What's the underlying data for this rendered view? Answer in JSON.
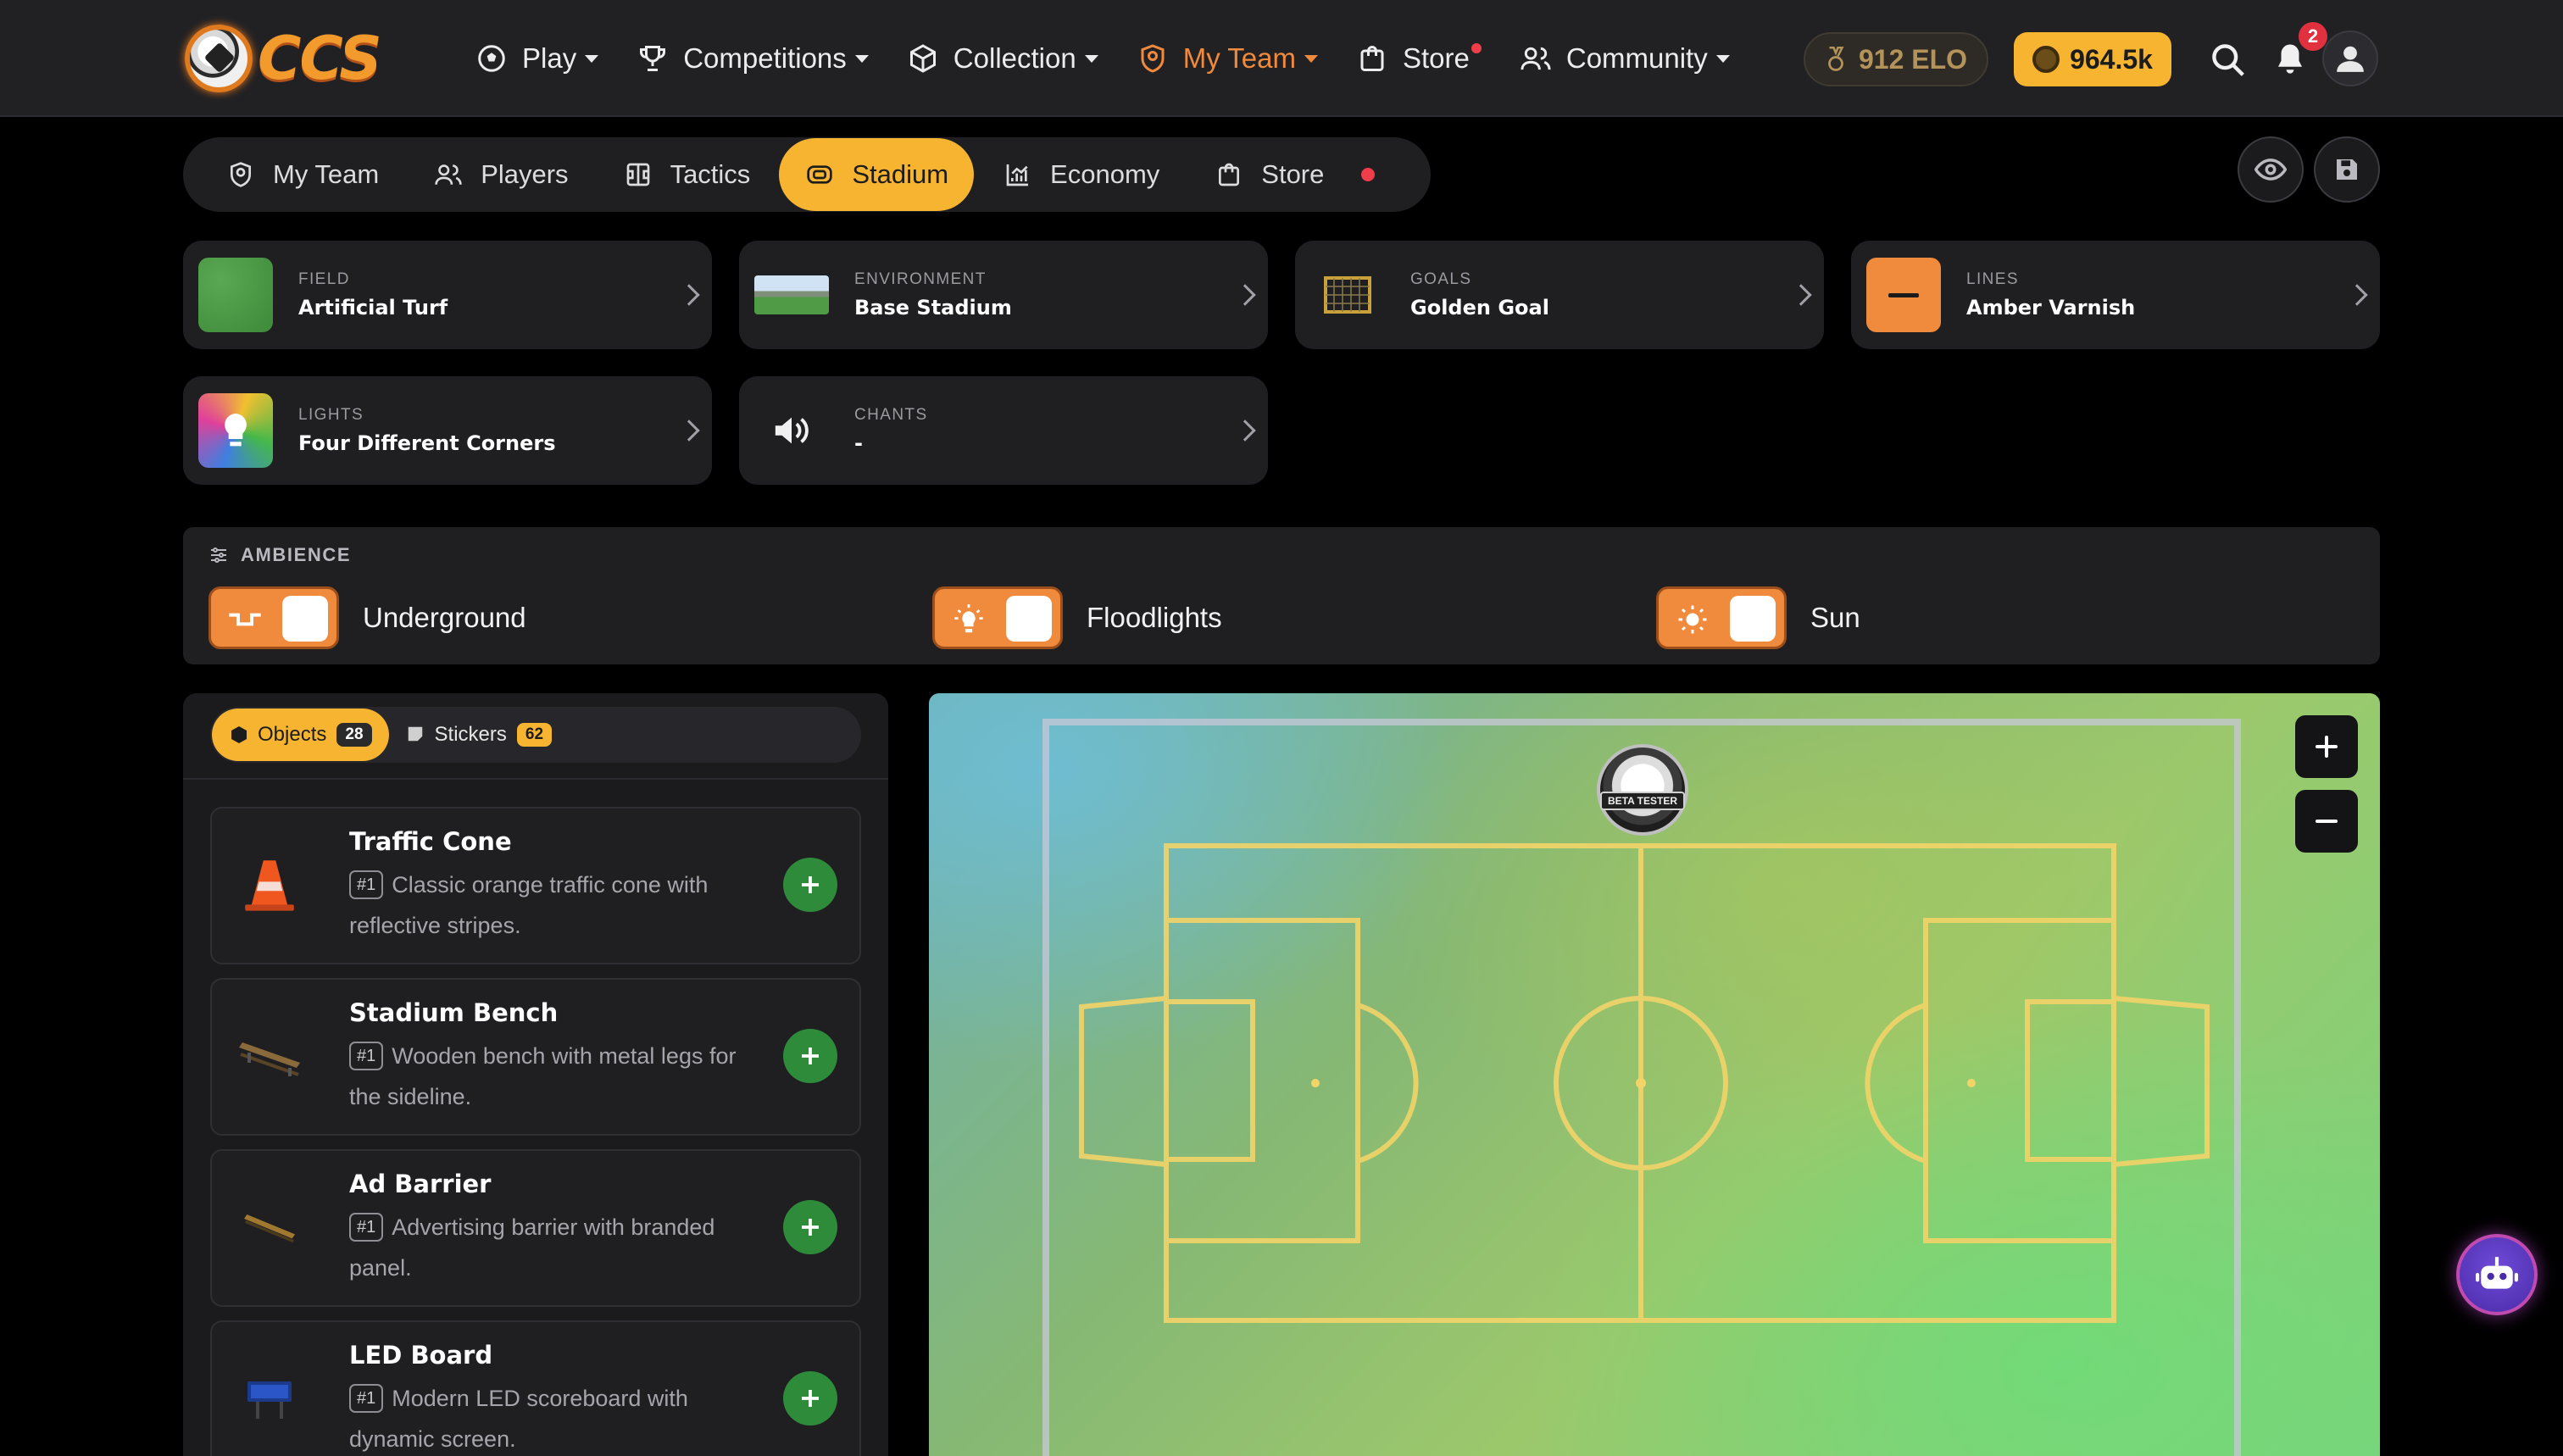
{
  "brand": {
    "logo_text": "CCS"
  },
  "nav": {
    "items": [
      {
        "label": "Play",
        "icon": "soccer-ball-icon"
      },
      {
        "label": "Competitions",
        "icon": "trophy-icon"
      },
      {
        "label": "Collection",
        "icon": "cube-icon"
      },
      {
        "label": "My Team",
        "icon": "shield-icon",
        "active": true
      },
      {
        "label": "Store",
        "icon": "bag-icon",
        "dot": true
      },
      {
        "label": "Community",
        "icon": "users-icon"
      }
    ],
    "elo": "912 ELO",
    "coins": "964.5k",
    "notifications": "2"
  },
  "subtabs": {
    "items": [
      {
        "label": "My Team",
        "icon": "shield-icon"
      },
      {
        "label": "Players",
        "icon": "users-icon"
      },
      {
        "label": "Tactics",
        "icon": "tactics-board-icon"
      },
      {
        "label": "Stadium",
        "icon": "stadium-icon",
        "active": true
      },
      {
        "label": "Economy",
        "icon": "chart-icon"
      },
      {
        "label": "Store",
        "icon": "bag-icon",
        "dot": true
      }
    ]
  },
  "config": {
    "field": {
      "label": "FIELD",
      "value": "Artificial Turf"
    },
    "environment": {
      "label": "ENVIRONMENT",
      "value": "Base Stadium"
    },
    "goals": {
      "label": "GOALS",
      "value": "Golden Goal"
    },
    "lines": {
      "label": "LINES",
      "value": "Amber Varnish"
    },
    "lights": {
      "label": "LIGHTS",
      "value": "Four Different Corners"
    },
    "chants": {
      "label": "CHANTS",
      "value": "-"
    }
  },
  "ambience": {
    "title": "AMBIENCE",
    "toggles": [
      {
        "label": "Underground",
        "icon": "underground-icon",
        "on": true
      },
      {
        "label": "Floodlights",
        "icon": "floodlight-icon",
        "on": true
      },
      {
        "label": "Sun",
        "icon": "sun-icon",
        "on": true
      }
    ]
  },
  "panel": {
    "tabs": [
      {
        "label": "Objects",
        "count": "28",
        "icon": "cube-icon",
        "active": true
      },
      {
        "label": "Stickers",
        "count": "62",
        "icon": "sticker-icon"
      }
    ],
    "objects": [
      {
        "title": "Traffic Cone",
        "tag": "#1",
        "description": "Classic orange traffic cone with reflective stripes.",
        "icon": "traffic-cone-icon"
      },
      {
        "title": "Stadium Bench",
        "tag": "#1",
        "description": "Wooden bench with metal legs for the sideline.",
        "icon": "bench-icon"
      },
      {
        "title": "Ad Barrier",
        "tag": "#1",
        "description": "Advertising barrier with branded panel.",
        "icon": "ad-barrier-icon"
      },
      {
        "title": "LED Board",
        "tag": "#1",
        "description": "Modern LED scoreboard with dynamic screen.",
        "icon": "led-board-icon"
      }
    ]
  },
  "pitch": {
    "sticker_text": "BETA TESTER",
    "line_color": "#f2d469",
    "zoom_in": "+",
    "zoom_out": "−"
  },
  "colors": {
    "accent": "#f6b430",
    "active_nav": "#f08a3c",
    "add_button": "#2e8b3a",
    "badge": "#e2313e"
  }
}
